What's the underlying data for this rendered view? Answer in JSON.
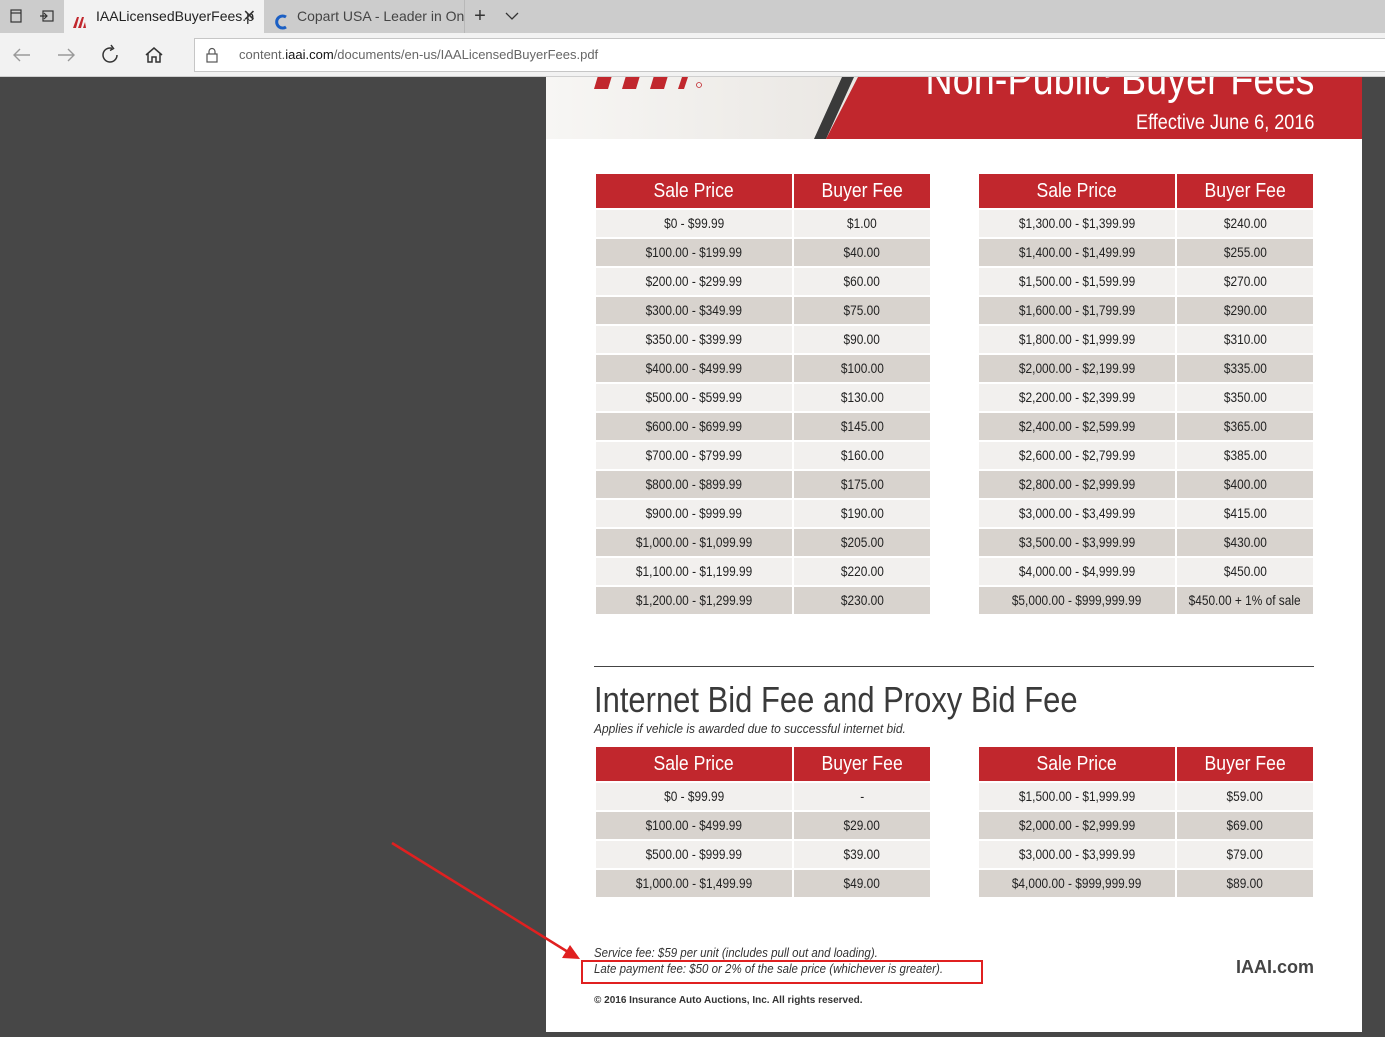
{
  "browser": {
    "tabs": [
      {
        "title": "IAALicensedBuyerFees.p",
        "active": true
      },
      {
        "title": "Copart USA - Leader in Onli",
        "active": false
      }
    ],
    "new_tab_label": "+",
    "tab_list_label": "⌵",
    "url_prefix": "content.",
    "url_domain": "iaai.com",
    "url_path": "/documents/en-us/IAALicensedBuyerFees.pdf"
  },
  "pdf": {
    "banner_title": "Non-Public Buyer Fees",
    "banner_subtitle": "Effective June 6, 2016",
    "headers": {
      "sale_price": "Sale Price",
      "buyer_fee": "Buyer Fee"
    },
    "table_left": [
      [
        "$0 - $99.99",
        "$1.00"
      ],
      [
        "$100.00 - $199.99",
        "$40.00"
      ],
      [
        "$200.00 - $299.99",
        "$60.00"
      ],
      [
        "$300.00 - $349.99",
        "$75.00"
      ],
      [
        "$350.00 - $399.99",
        "$90.00"
      ],
      [
        "$400.00 - $499.99",
        "$100.00"
      ],
      [
        "$500.00 - $599.99",
        "$130.00"
      ],
      [
        "$600.00 - $699.99",
        "$145.00"
      ],
      [
        "$700.00 - $799.99",
        "$160.00"
      ],
      [
        "$800.00 - $899.99",
        "$175.00"
      ],
      [
        "$900.00 - $999.99",
        "$190.00"
      ],
      [
        "$1,000.00 - $1,099.99",
        "$205.00"
      ],
      [
        "$1,100.00 - $1,199.99",
        "$220.00"
      ],
      [
        "$1,200.00 - $1,299.99",
        "$230.00"
      ]
    ],
    "table_right": [
      [
        "$1,300.00 - $1,399.99",
        "$240.00"
      ],
      [
        "$1,400.00 - $1,499.99",
        "$255.00"
      ],
      [
        "$1,500.00 - $1,599.99",
        "$270.00"
      ],
      [
        "$1,600.00 - $1,799.99",
        "$290.00"
      ],
      [
        "$1,800.00 - $1,999.99",
        "$310.00"
      ],
      [
        "$2,000.00 - $2,199.99",
        "$335.00"
      ],
      [
        "$2,200.00 - $2,399.99",
        "$350.00"
      ],
      [
        "$2,400.00 - $2,599.99",
        "$365.00"
      ],
      [
        "$2,600.00 - $2,799.99",
        "$385.00"
      ],
      [
        "$2,800.00 - $2,999.99",
        "$400.00"
      ],
      [
        "$3,000.00 - $3,499.99",
        "$415.00"
      ],
      [
        "$3,500.00 - $3,999.99",
        "$430.00"
      ],
      [
        "$4,000.00 - $4,999.99",
        "$450.00"
      ],
      [
        "$5,000.00 - $999,999.99",
        "$450.00 + 1% of sale"
      ]
    ],
    "internet_section_title": "Internet Bid Fee and Proxy Bid Fee",
    "internet_section_subtitle": "Applies if vehicle is awarded due to successful internet bid.",
    "internet_left": [
      [
        "$0 - $99.99",
        "-"
      ],
      [
        "$100.00 - $499.99",
        "$29.00"
      ],
      [
        "$500.00 - $999.99",
        "$39.00"
      ],
      [
        "$1,000.00 - $1,499.99",
        "$49.00"
      ]
    ],
    "internet_right": [
      [
        "$1,500.00 - $1,999.99",
        "$59.00"
      ],
      [
        "$2,000.00 - $2,999.99",
        "$69.00"
      ],
      [
        "$3,000.00 - $3,999.99",
        "$79.00"
      ],
      [
        "$4,000.00 - $999,999.99",
        "$89.00"
      ]
    ],
    "service_fee": "Service fee: $59 per unit (includes pull out and loading).",
    "late_payment_fee": "Late payment fee: $50 or 2% of the sale price (whichever is greater).",
    "site": "IAAI.com",
    "copyright": "© 2016 Insurance Auto Auctions, Inc. All rights reserved."
  },
  "colors": {
    "brand_red": "#c1272d",
    "annotation_red": "#e02020"
  }
}
